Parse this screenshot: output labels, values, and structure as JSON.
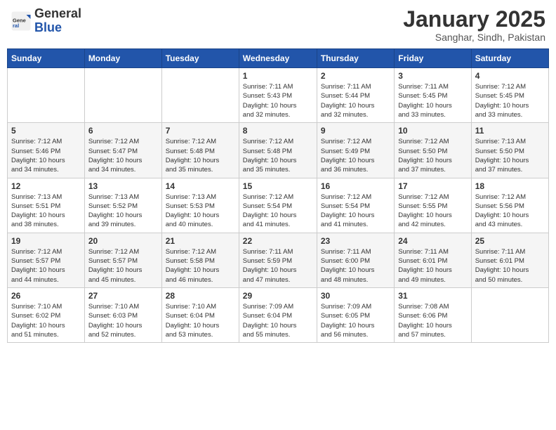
{
  "header": {
    "logo_general": "General",
    "logo_blue": "Blue",
    "month_title": "January 2025",
    "location": "Sanghar, Sindh, Pakistan"
  },
  "weekdays": [
    "Sunday",
    "Monday",
    "Tuesday",
    "Wednesday",
    "Thursday",
    "Friday",
    "Saturday"
  ],
  "weeks": [
    [
      {
        "day": "",
        "info": ""
      },
      {
        "day": "",
        "info": ""
      },
      {
        "day": "",
        "info": ""
      },
      {
        "day": "1",
        "info": "Sunrise: 7:11 AM\nSunset: 5:43 PM\nDaylight: 10 hours\nand 32 minutes."
      },
      {
        "day": "2",
        "info": "Sunrise: 7:11 AM\nSunset: 5:44 PM\nDaylight: 10 hours\nand 32 minutes."
      },
      {
        "day": "3",
        "info": "Sunrise: 7:11 AM\nSunset: 5:45 PM\nDaylight: 10 hours\nand 33 minutes."
      },
      {
        "day": "4",
        "info": "Sunrise: 7:12 AM\nSunset: 5:45 PM\nDaylight: 10 hours\nand 33 minutes."
      }
    ],
    [
      {
        "day": "5",
        "info": "Sunrise: 7:12 AM\nSunset: 5:46 PM\nDaylight: 10 hours\nand 34 minutes."
      },
      {
        "day": "6",
        "info": "Sunrise: 7:12 AM\nSunset: 5:47 PM\nDaylight: 10 hours\nand 34 minutes."
      },
      {
        "day": "7",
        "info": "Sunrise: 7:12 AM\nSunset: 5:48 PM\nDaylight: 10 hours\nand 35 minutes."
      },
      {
        "day": "8",
        "info": "Sunrise: 7:12 AM\nSunset: 5:48 PM\nDaylight: 10 hours\nand 35 minutes."
      },
      {
        "day": "9",
        "info": "Sunrise: 7:12 AM\nSunset: 5:49 PM\nDaylight: 10 hours\nand 36 minutes."
      },
      {
        "day": "10",
        "info": "Sunrise: 7:12 AM\nSunset: 5:50 PM\nDaylight: 10 hours\nand 37 minutes."
      },
      {
        "day": "11",
        "info": "Sunrise: 7:13 AM\nSunset: 5:50 PM\nDaylight: 10 hours\nand 37 minutes."
      }
    ],
    [
      {
        "day": "12",
        "info": "Sunrise: 7:13 AM\nSunset: 5:51 PM\nDaylight: 10 hours\nand 38 minutes."
      },
      {
        "day": "13",
        "info": "Sunrise: 7:13 AM\nSunset: 5:52 PM\nDaylight: 10 hours\nand 39 minutes."
      },
      {
        "day": "14",
        "info": "Sunrise: 7:13 AM\nSunset: 5:53 PM\nDaylight: 10 hours\nand 40 minutes."
      },
      {
        "day": "15",
        "info": "Sunrise: 7:12 AM\nSunset: 5:54 PM\nDaylight: 10 hours\nand 41 minutes."
      },
      {
        "day": "16",
        "info": "Sunrise: 7:12 AM\nSunset: 5:54 PM\nDaylight: 10 hours\nand 41 minutes."
      },
      {
        "day": "17",
        "info": "Sunrise: 7:12 AM\nSunset: 5:55 PM\nDaylight: 10 hours\nand 42 minutes."
      },
      {
        "day": "18",
        "info": "Sunrise: 7:12 AM\nSunset: 5:56 PM\nDaylight: 10 hours\nand 43 minutes."
      }
    ],
    [
      {
        "day": "19",
        "info": "Sunrise: 7:12 AM\nSunset: 5:57 PM\nDaylight: 10 hours\nand 44 minutes."
      },
      {
        "day": "20",
        "info": "Sunrise: 7:12 AM\nSunset: 5:57 PM\nDaylight: 10 hours\nand 45 minutes."
      },
      {
        "day": "21",
        "info": "Sunrise: 7:12 AM\nSunset: 5:58 PM\nDaylight: 10 hours\nand 46 minutes."
      },
      {
        "day": "22",
        "info": "Sunrise: 7:11 AM\nSunset: 5:59 PM\nDaylight: 10 hours\nand 47 minutes."
      },
      {
        "day": "23",
        "info": "Sunrise: 7:11 AM\nSunset: 6:00 PM\nDaylight: 10 hours\nand 48 minutes."
      },
      {
        "day": "24",
        "info": "Sunrise: 7:11 AM\nSunset: 6:01 PM\nDaylight: 10 hours\nand 49 minutes."
      },
      {
        "day": "25",
        "info": "Sunrise: 7:11 AM\nSunset: 6:01 PM\nDaylight: 10 hours\nand 50 minutes."
      }
    ],
    [
      {
        "day": "26",
        "info": "Sunrise: 7:10 AM\nSunset: 6:02 PM\nDaylight: 10 hours\nand 51 minutes."
      },
      {
        "day": "27",
        "info": "Sunrise: 7:10 AM\nSunset: 6:03 PM\nDaylight: 10 hours\nand 52 minutes."
      },
      {
        "day": "28",
        "info": "Sunrise: 7:10 AM\nSunset: 6:04 PM\nDaylight: 10 hours\nand 53 minutes."
      },
      {
        "day": "29",
        "info": "Sunrise: 7:09 AM\nSunset: 6:04 PM\nDaylight: 10 hours\nand 55 minutes."
      },
      {
        "day": "30",
        "info": "Sunrise: 7:09 AM\nSunset: 6:05 PM\nDaylight: 10 hours\nand 56 minutes."
      },
      {
        "day": "31",
        "info": "Sunrise: 7:08 AM\nSunset: 6:06 PM\nDaylight: 10 hours\nand 57 minutes."
      },
      {
        "day": "",
        "info": ""
      }
    ]
  ]
}
